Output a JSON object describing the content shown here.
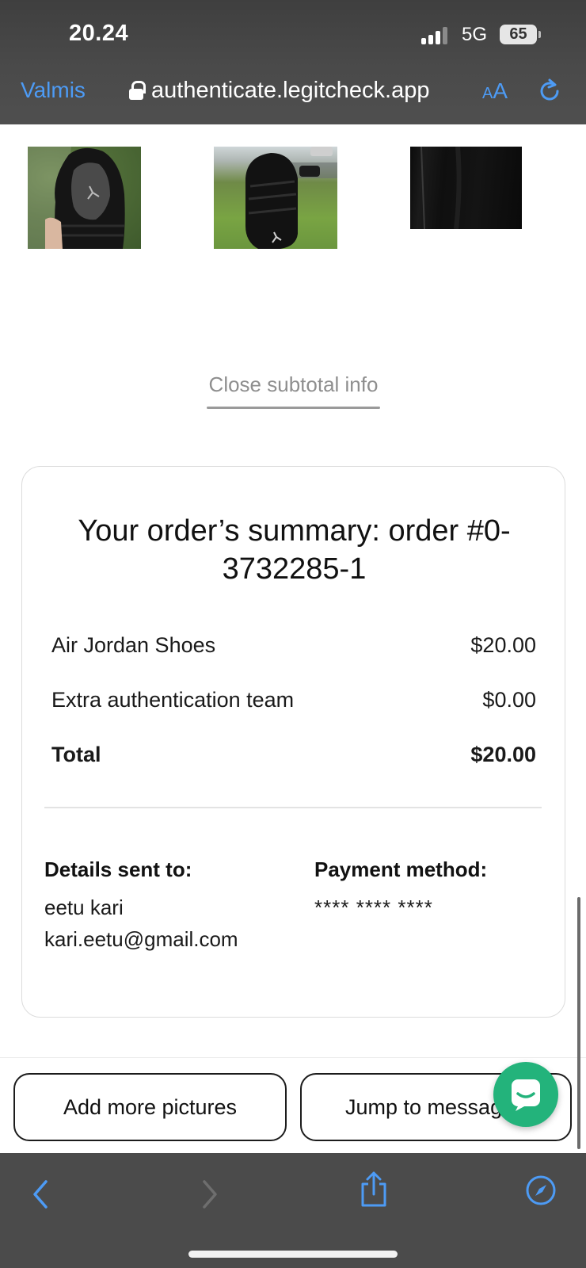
{
  "status_bar": {
    "time": "20.24",
    "network": "5G",
    "battery": "65"
  },
  "browser": {
    "back_label": "Valmis",
    "url": "authenticate.legitcheck.app",
    "text_size_small": "A",
    "text_size_large": "A"
  },
  "page": {
    "close_subtotal_label": "Close subtotal info",
    "summary": {
      "title": "Your order’s summary: order #0-3732285-1",
      "items": [
        {
          "label": "Air Jordan Shoes",
          "price": "$20.00"
        },
        {
          "label": "Extra authentication team",
          "price": "$0.00"
        }
      ],
      "total_label": "Total",
      "total_price": "$20.00",
      "details_heading": "Details sent to:",
      "details_name": "eetu kari",
      "details_email": "kari.eetu@gmail.com",
      "payment_heading": "Payment method:",
      "payment_masked": "**** **** ****"
    },
    "actions": {
      "add_pictures_label": "Add more pictures",
      "jump_label": "Jump to messages"
    }
  },
  "colors": {
    "accent_blue": "#4d9bf5",
    "chat_green": "#23b37b",
    "toolbar_gray": "#4b4b4b"
  },
  "icons": [
    "lock-icon",
    "reload-icon",
    "chat-icon",
    "back-arrow-icon",
    "forward-arrow-icon",
    "share-icon",
    "compass-icon"
  ]
}
